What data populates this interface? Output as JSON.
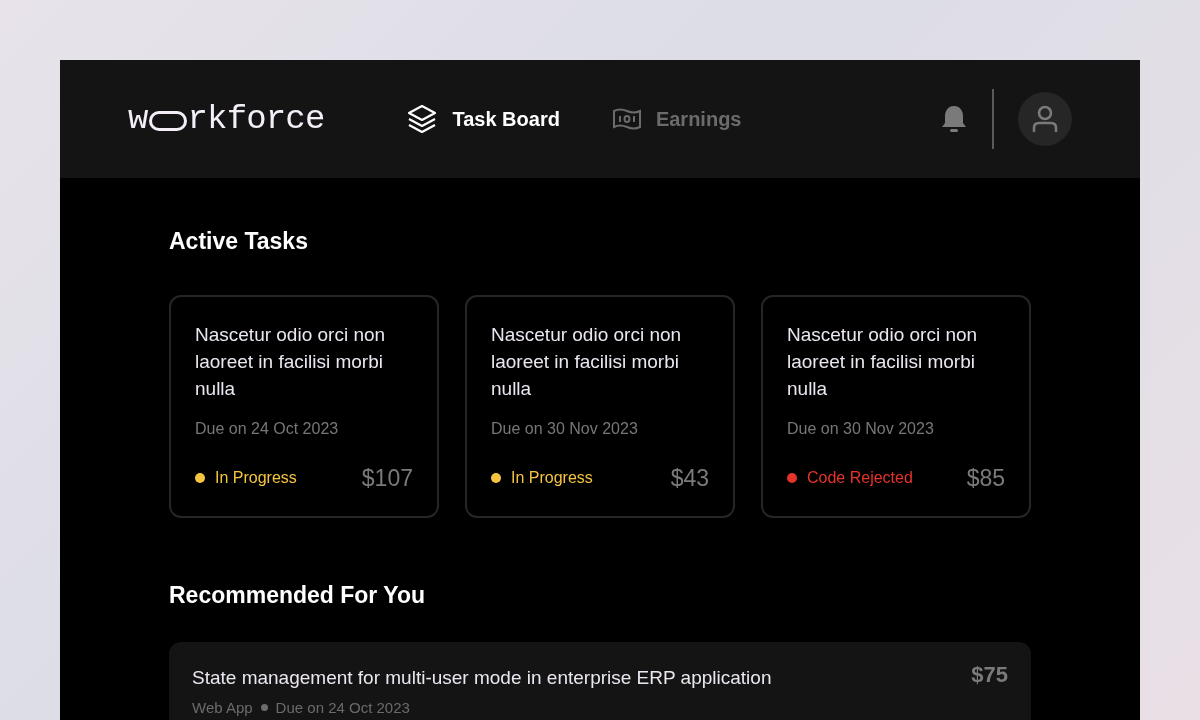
{
  "header": {
    "logo": {
      "before": "w",
      "after": "rkforce"
    },
    "nav": [
      {
        "label": "Task Board",
        "kind": "layers",
        "selected": true
      },
      {
        "label": "Earnings",
        "kind": "money",
        "selected": false
      }
    ]
  },
  "active_tasks": {
    "title": "Active Tasks",
    "cards": [
      {
        "title": "Nascetur odio orci non laoreet in facilisi morbi nulla",
        "due": "Due on 24 Oct 2023",
        "status": "In Progress",
        "color": "#f5c542",
        "price": "$107"
      },
      {
        "title": "Nascetur odio orci non laoreet in facilisi morbi nulla",
        "due": "Due on 30 Nov 2023",
        "status": "In Progress",
        "color": "#f5c542",
        "price": "$43"
      },
      {
        "title": "Nascetur odio orci non laoreet in facilisi morbi nulla",
        "due": "Due on 30 Nov 2023",
        "status": "Code Rejected",
        "color": "#e5332a",
        "price": "$85"
      }
    ]
  },
  "recommended": {
    "title": "Recommended For You",
    "items": [
      {
        "title": "State management for multi-user mode in enterprise ERP application",
        "category": "Web App",
        "due": "Due on 24 Oct 2023",
        "price": "$75"
      }
    ]
  }
}
